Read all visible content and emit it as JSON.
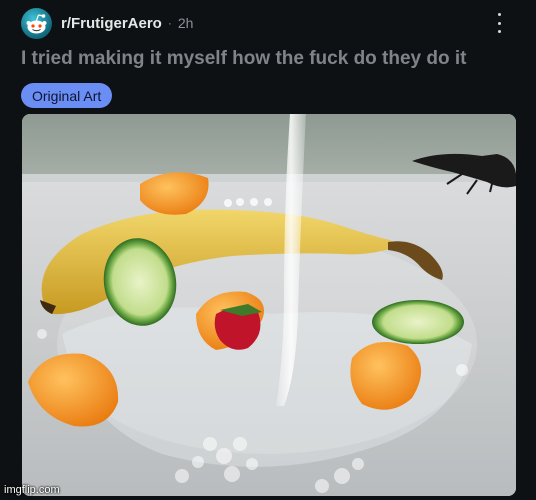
{
  "post": {
    "subreddit": "r/FrutigerAero",
    "separator": "·",
    "time": "2h",
    "title": "I tried making it myself how the fuck do they do it",
    "flair": "Original Art"
  },
  "watermark": "imgflip.com",
  "icons": {
    "avatar": "reddit-snoo-avatar-icon",
    "more": "more-vertical-icon"
  },
  "colors": {
    "background": "#0e1113",
    "flair_bg": "#6b8ef5",
    "avatar_bg": "#2aa6bd"
  }
}
